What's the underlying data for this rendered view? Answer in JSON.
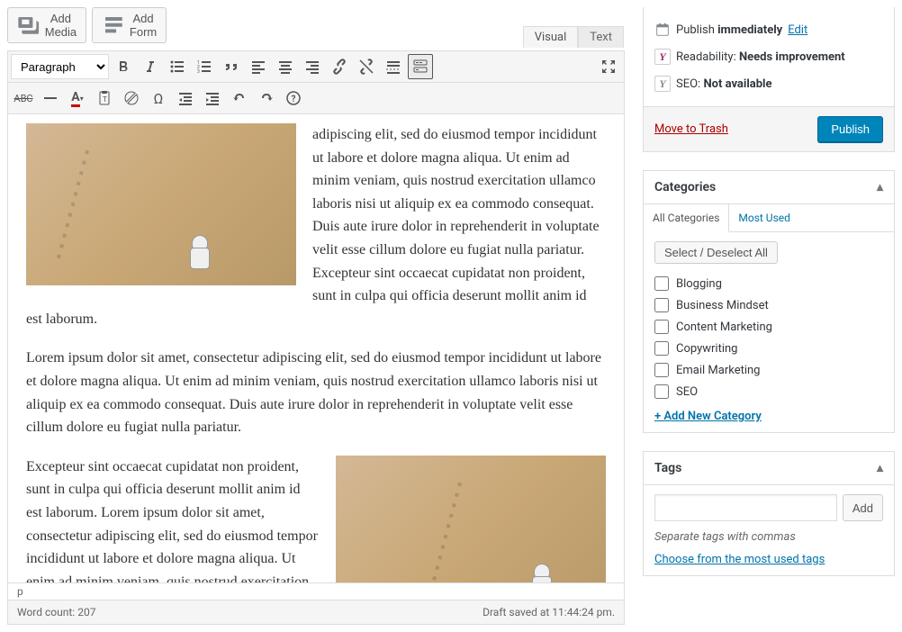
{
  "media": {
    "add_media": "Add Media",
    "add_form": "Add Form"
  },
  "editor_tabs": {
    "visual": "Visual",
    "text": "Text"
  },
  "format_dropdown": "Paragraph",
  "content": {
    "p1": "adipiscing elit, sed do eiusmod tempor incididunt ut labore et dolore magna aliqua. Ut enim ad minim veniam, quis nostrud exercitation ullamco laboris nisi ut aliquip ex ea commodo consequat. Duis aute irure dolor in reprehenderit in voluptate velit esse cillum dolore eu fugiat nulla pariatur. Excepteur sint occaecat cupidatat non proident, sunt in culpa qui officia deserunt mollit anim id est laborum.",
    "p2": "Lorem ipsum dolor sit amet, consectetur adipiscing elit, sed do eiusmod tempor incididunt ut labore et dolore magna aliqua. Ut enim ad minim veniam, quis nostrud exercitation ullamco laboris nisi ut aliquip ex ea commodo consequat. Duis aute irure dolor in reprehenderit in voluptate velit esse cillum dolore eu fugiat nulla pariatur.",
    "p3": "Excepteur sint occaecat cupidatat non proident, sunt in culpa qui officia deserunt mollit anim id est laborum. Lorem ipsum dolor sit amet, consectetur adipiscing elit, sed do eiusmod tempor incididunt ut labore et dolore magna aliqua. Ut enim ad minim veniam, quis nostrud exercitation ullamco laboris nisi ut aliquip ex ea commodo consequat. Duis aute irure dolor in"
  },
  "status": {
    "path": "p",
    "word_count_label": "Word count:",
    "word_count": "207",
    "draft_saved": "Draft saved at 11:44:24 pm."
  },
  "publish_box": {
    "schedule_prefix": "Publish",
    "schedule_value": "immediately",
    "edit_link": "Edit",
    "readability_label": "Readability:",
    "readability_value": "Needs improvement",
    "seo_label": "SEO:",
    "seo_value": "Not available",
    "trash": "Move to Trash",
    "publish_btn": "Publish"
  },
  "categories": {
    "header": "Categories",
    "tab_all": "All Categories",
    "tab_most": "Most Used",
    "select_all": "Select / Deselect All",
    "items": [
      "Blogging",
      "Business Mindset",
      "Content Marketing",
      "Copywriting",
      "Email Marketing",
      "SEO"
    ],
    "add_new": "+ Add New Category"
  },
  "tags": {
    "header": "Tags",
    "add_btn": "Add",
    "hint": "Separate tags with commas",
    "choose_link": "Choose from the most used tags"
  }
}
